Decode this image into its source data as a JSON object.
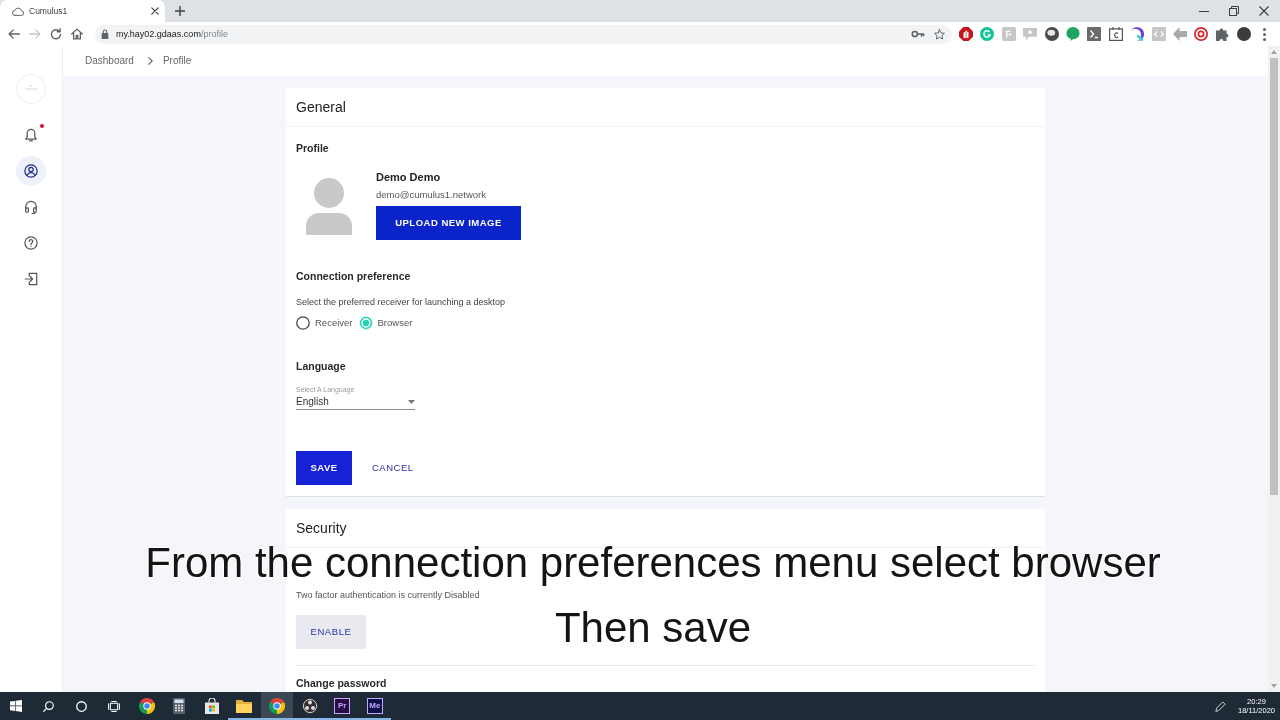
{
  "browser": {
    "tabs": [
      {
        "title": "Cumulus1",
        "selected": true
      }
    ],
    "nav": [
      {
        "kind": "back",
        "disabled": false
      },
      {
        "kind": "forward",
        "disabled": true
      },
      {
        "kind": "reload",
        "disabled": false
      },
      {
        "kind": "home",
        "disabled": false
      }
    ],
    "url": {
      "host": "my.hay02.gdaas.com",
      "path": "/profile"
    }
  },
  "sidebar": {
    "items": [
      {
        "kind": "notifications",
        "selected": false,
        "unread": true
      },
      {
        "kind": "profile",
        "selected": true,
        "unread": false
      },
      {
        "kind": "support",
        "selected": false,
        "unread": false
      },
      {
        "kind": "help",
        "selected": false,
        "unread": false
      },
      {
        "kind": "logout",
        "selected": false,
        "unread": false
      }
    ]
  },
  "breadcrumb": [
    "Dashboard",
    "Profile"
  ],
  "general": {
    "title": "General",
    "profile": {
      "heading": "Profile",
      "name": "Demo Demo",
      "email": "demo@cumulus1.network",
      "upload_button": "UPLOAD NEW IMAGE"
    },
    "connection": {
      "heading": "Connection preference",
      "description": "Select the preferred receiver for launching a desktop",
      "options": [
        {
          "label": "Receiver",
          "selected": false
        },
        {
          "label": "Browser",
          "selected": true
        }
      ]
    },
    "language": {
      "heading": "Language",
      "label": "Select A Language",
      "value": "English"
    },
    "actions": [
      {
        "kind": "primary",
        "label": "SAVE"
      },
      {
        "kind": "text",
        "label": "CANCEL"
      }
    ]
  },
  "security": {
    "title": "Security",
    "two_factor": {
      "status": "Two factor authentication is currently Disabled",
      "button": "ENABLE"
    },
    "change_password": {
      "heading": "Change password"
    }
  },
  "caption": [
    "From the connection preferences menu select browser",
    "Then save"
  ],
  "taskbar": {
    "apps": [
      {
        "kind": "browser",
        "running": false,
        "selected": false
      },
      {
        "kind": "calculator",
        "running": false,
        "selected": false
      },
      {
        "kind": "store",
        "running": false,
        "selected": false
      },
      {
        "kind": "folder",
        "running": true,
        "selected": false
      },
      {
        "kind": "browser",
        "running": true,
        "selected": true
      },
      {
        "kind": "recorder",
        "running": true,
        "selected": false
      },
      {
        "kind": "tile",
        "label": "Pr",
        "color": "#2a0c45",
        "running": true,
        "selected": false
      },
      {
        "kind": "tile",
        "label": "Me",
        "color": "#10104a",
        "running": true,
        "selected": false
      }
    ],
    "clock": {
      "time": "20:29",
      "date": "18/11/2020"
    }
  }
}
